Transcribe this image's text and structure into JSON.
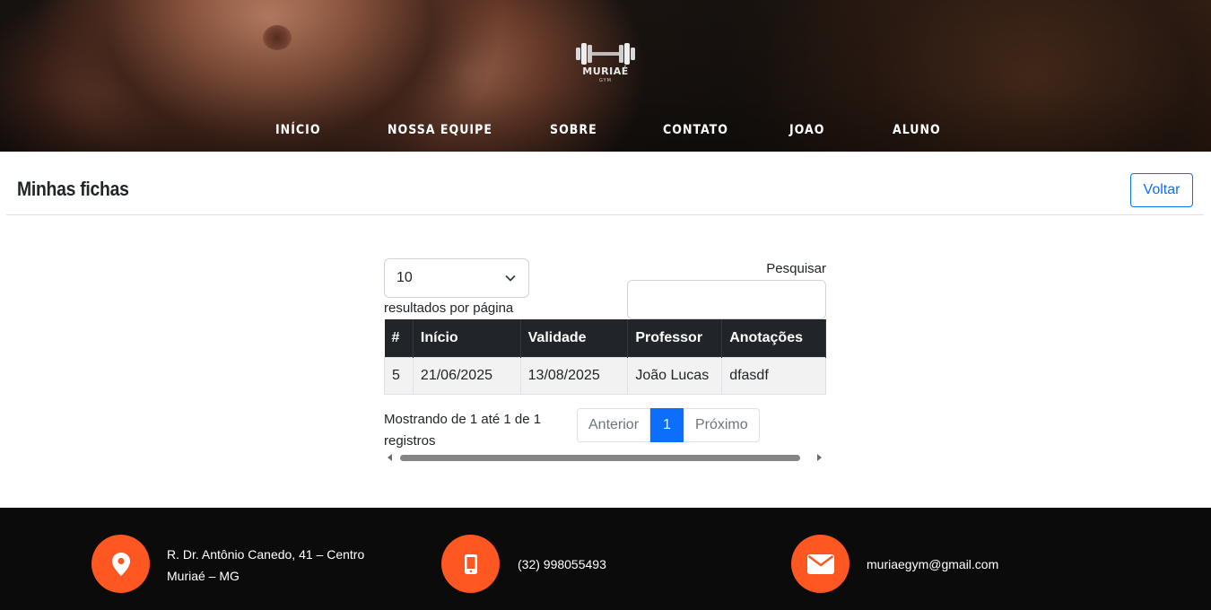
{
  "brand": {
    "logo_text": "MURIAÉ",
    "logo_sub": "GYM"
  },
  "nav": {
    "items": [
      {
        "label": "INÍCIO"
      },
      {
        "label": "NOSSA EQUIPE"
      },
      {
        "label": "SOBRE"
      },
      {
        "label": "CONTATO"
      },
      {
        "label": "JOAO"
      },
      {
        "label": "ALUNO"
      }
    ]
  },
  "page": {
    "title": "Minhas fichas",
    "back_label": "Voltar"
  },
  "table_controls": {
    "page_length_value": "10",
    "page_length_label": "resultados por página",
    "search_label": "Pesquisar",
    "search_value": ""
  },
  "table": {
    "columns": [
      "#",
      "Início",
      "Validade",
      "Professor",
      "Anotações"
    ],
    "rows": [
      [
        "5",
        "21/06/2025",
        "13/08/2025",
        "João Lucas",
        "dfasdf"
      ]
    ]
  },
  "pagination": {
    "info": "Mostrando de 1 até 1 de 1 registros",
    "previous_label": "Anterior",
    "current_page": "1",
    "next_label": "Próximo"
  },
  "footer": {
    "address_line1": "R. Dr. Antônio Canedo, 41 – Centro",
    "address_line2": "Muriaé – MG",
    "phone": "(32) 998055493",
    "email": "muriaegym@gmail.com",
    "icon_color": "#ff5722"
  },
  "colors": {
    "accent": "#0d6efd",
    "table_header": "#212529",
    "footer_bg": "#0b0b0b"
  }
}
